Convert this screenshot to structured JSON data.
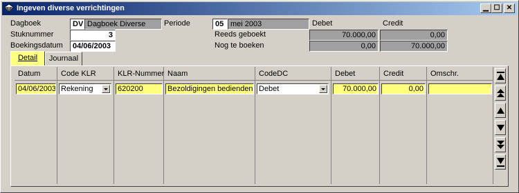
{
  "window": {
    "title": "Ingeven diverse verrichtingen"
  },
  "header": {
    "dagboek_label": "Dagboek",
    "dagboek_code": "DV",
    "dagboek_name": "Dagboek Diverse",
    "periode_label": "Periode",
    "periode_code": "05",
    "periode_name": "mei 2003",
    "debet_label": "Debet",
    "credit_label": "Credit",
    "stuknummer_label": "Stuknummer",
    "stuknummer_value": "3",
    "reeds_label": "Reeds geboekt",
    "reeds_debet": "70.000,00",
    "reeds_credit": "0,00",
    "boekingsdatum_label": "Boekingsdatum",
    "boekingsdatum_value": "04/06/2003",
    "nog_label": "Nog te boeken",
    "nog_debet": "0,00",
    "nog_credit": "70.000,00"
  },
  "tabs": [
    {
      "label": "Detail",
      "active": true
    },
    {
      "label": "Journaal",
      "active": false
    }
  ],
  "grid": {
    "columns": [
      "Datum",
      "Code KLR",
      "KLR-Nummer",
      "Naam",
      "CodeDC",
      "Debet",
      "Credit",
      "Omschr."
    ],
    "rows": [
      {
        "datum": "04/06/2003",
        "code_klr": "Rekening",
        "klr_nummer": "620200",
        "naam": "Bezoldigingen bedienden",
        "code_dc": "Debet",
        "debet": "70.000,00",
        "credit": "0,00",
        "omschr": ""
      }
    ]
  },
  "colors": {
    "highlight": "#ffff80",
    "title_start": "#0a246a",
    "title_end": "#a6caf0",
    "face": "#d4d0c8",
    "readonly": "#a0a0a0"
  },
  "icons": [
    "app-icon",
    "minimize-icon",
    "maximize-icon",
    "close-icon",
    "first-record-icon",
    "page-up-icon",
    "previous-record-icon",
    "next-record-icon",
    "page-down-icon",
    "last-record-icon",
    "dropdown-arrow-icon"
  ]
}
